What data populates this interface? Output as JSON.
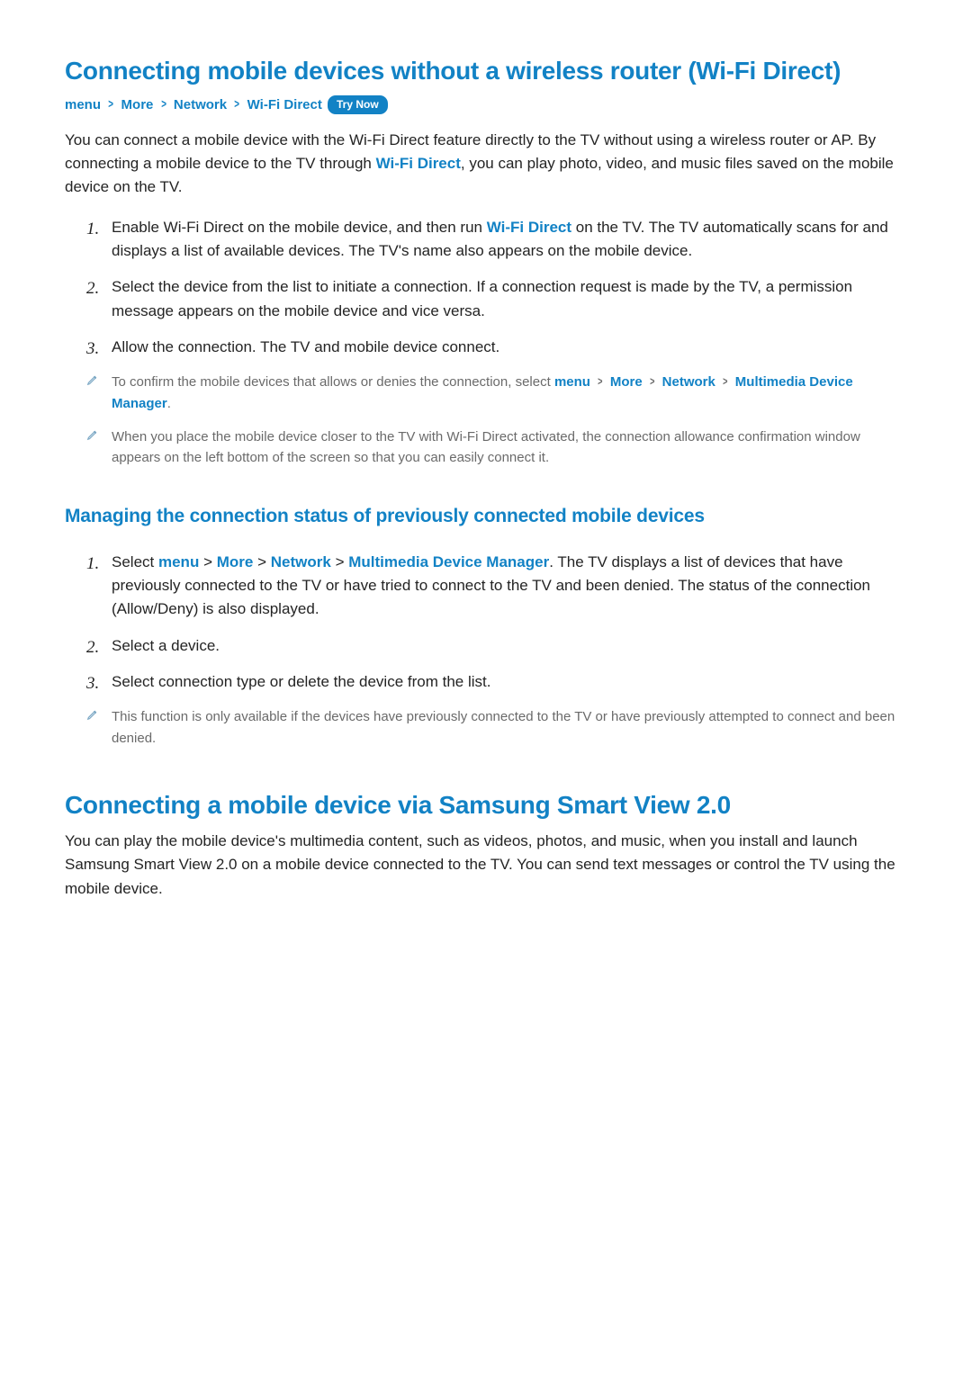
{
  "section1": {
    "title": "Connecting mobile devices without a wireless router (Wi-Fi Direct)",
    "breadcrumb": {
      "p1": "menu",
      "p2": "More",
      "p3": "Network",
      "p4": "Wi-Fi Direct"
    },
    "try_now": "Try Now",
    "intro_before": "You can connect a mobile device with the Wi-Fi Direct feature directly to the TV without using a wireless router or AP. By connecting a mobile device to the TV through ",
    "intro_term": "Wi-Fi Direct",
    "intro_after": ", you can play photo, video, and music files saved on the mobile device on the TV.",
    "steps": [
      {
        "before": "Enable Wi-Fi Direct on the mobile device, and then run ",
        "term": "Wi-Fi Direct",
        "after": " on the TV. The TV automatically scans for and displays a list of available devices. The TV's name also appears on the mobile device."
      },
      {
        "text": "Select the device from the list to initiate a connection. If a connection request is made by the TV, a permission message appears on the mobile device and vice versa."
      },
      {
        "text": "Allow the connection. The TV and mobile device connect."
      }
    ],
    "note1_before": "To confirm the mobile devices that allows or denies the connection, select ",
    "note1_crumb": {
      "p1": "menu",
      "p2": "More",
      "p3": "Network",
      "p4": "Multimedia Device Manager"
    },
    "note1_after": ".",
    "note2": "When you place the mobile device closer to the TV with Wi-Fi Direct activated, the connection allowance confirmation window appears on the left bottom of the screen so that you can easily connect it."
  },
  "section2": {
    "title": "Managing the connection status of previously connected mobile devices",
    "steps": [
      {
        "before": "Select ",
        "crumb": {
          "p1": "menu",
          "p2": "More",
          "p3": "Network",
          "p4": "Multimedia Device Manager"
        },
        "after": ". The TV displays a list of devices that have previously connected to the TV or have tried to connect to the TV and been denied. The status of the connection (Allow/Deny) is also displayed."
      },
      {
        "text": "Select a device."
      },
      {
        "text": "Select connection type or delete the device from the list."
      }
    ],
    "note": "This function is only available if the devices have previously connected to the TV or have previously attempted to connect and been denied."
  },
  "section3": {
    "title": "Connecting a mobile device via Samsung Smart View 2.0",
    "body": "You can play the mobile device's multimedia content, such as videos, photos, and music, when you install and launch Samsung Smart View 2.0 on a mobile device connected to the TV. You can send text messages or control the TV using the mobile device."
  },
  "chevron": ">"
}
